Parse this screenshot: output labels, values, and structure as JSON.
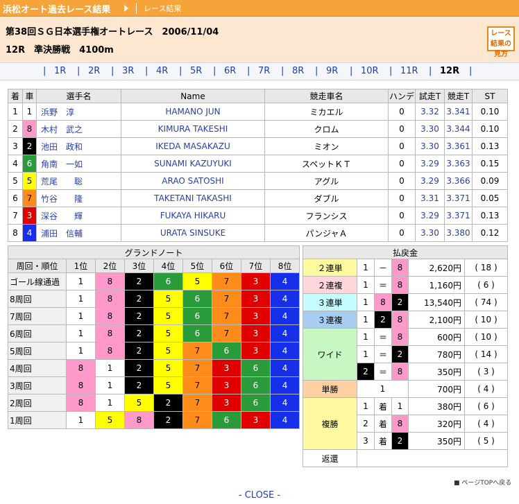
{
  "header": {
    "site_title": "浜松オート過去レース結果",
    "crumb": "レース結果"
  },
  "race": {
    "line1": "第38回ＳＧ日本選手権オートレース　2006/11/04",
    "line2": "12R　準決勝戦　4100m",
    "howto": "レース結果の見方"
  },
  "nav": {
    "tabs": [
      "1R",
      "2R",
      "3R",
      "4R",
      "5R",
      "6R",
      "7R",
      "8R",
      "9R",
      "10R",
      "11R",
      "12R"
    ],
    "current": "12R"
  },
  "results": {
    "headers": [
      "着",
      "車",
      "選手名",
      "Name",
      "競走車名",
      "ハンデ",
      "試走T",
      "競走T",
      "ST"
    ],
    "rows": [
      {
        "pos": "1",
        "car": "1",
        "name": "浜野　淳",
        "romaji": "HAMANO JUN",
        "bike": "ミカエル",
        "handicap": "0",
        "trial": "3.32",
        "race": "3.341",
        "st": "0.10"
      },
      {
        "pos": "2",
        "car": "8",
        "name": "木村　武之",
        "romaji": "KIMURA TAKESHI",
        "bike": "クロム",
        "handicap": "0",
        "trial": "3.30",
        "race": "3.344",
        "st": "0.10"
      },
      {
        "pos": "3",
        "car": "2",
        "name": "池田　政和",
        "romaji": "IKEDA MASAKAZU",
        "bike": "ミオン",
        "handicap": "0",
        "trial": "3.30",
        "race": "3.361",
        "st": "0.13"
      },
      {
        "pos": "4",
        "car": "6",
        "name": "角南　一如",
        "romaji": "SUNAMI KAZUYUKI",
        "bike": "スペットＫＴ",
        "handicap": "0",
        "trial": "3.29",
        "race": "3.363",
        "st": "0.15"
      },
      {
        "pos": "5",
        "car": "5",
        "name": "荒尾　　聡",
        "romaji": "ARAO SATOSHI",
        "bike": "アグル",
        "handicap": "0",
        "trial": "3.29",
        "race": "3.366",
        "st": "0.09"
      },
      {
        "pos": "6",
        "car": "7",
        "name": "竹谷　　隆",
        "romaji": "TAKETANI TAKASHI",
        "bike": "ダブル",
        "handicap": "0",
        "trial": "3.31",
        "race": "3.371",
        "st": "0.05"
      },
      {
        "pos": "7",
        "car": "3",
        "name": "深谷　　輝",
        "romaji": "FUKAYA HIKARU",
        "bike": "フランシス",
        "handicap": "0",
        "trial": "3.29",
        "race": "3.371",
        "st": "0.13"
      },
      {
        "pos": "8",
        "car": "4",
        "name": "浦田　信輔",
        "romaji": "URATA SINSUKE",
        "bike": "パンジャＡ",
        "handicap": "0",
        "trial": "3.30",
        "race": "3.380",
        "st": "0.12"
      }
    ]
  },
  "grand": {
    "title": "グランドノート",
    "headers": [
      "周回・順位",
      "1位",
      "2位",
      "3位",
      "4位",
      "5位",
      "6位",
      "7位",
      "8位"
    ],
    "rows": [
      {
        "lap": "ゴール線通過",
        "cars": [
          "1",
          "8",
          "2",
          "6",
          "5",
          "7",
          "3",
          "4"
        ]
      },
      {
        "lap": "8周回",
        "cars": [
          "1",
          "8",
          "2",
          "5",
          "6",
          "7",
          "3",
          "4"
        ]
      },
      {
        "lap": "7周回",
        "cars": [
          "1",
          "8",
          "2",
          "5",
          "6",
          "7",
          "3",
          "4"
        ]
      },
      {
        "lap": "6周回",
        "cars": [
          "1",
          "8",
          "2",
          "5",
          "6",
          "7",
          "3",
          "4"
        ]
      },
      {
        "lap": "5周回",
        "cars": [
          "1",
          "8",
          "2",
          "5",
          "7",
          "6",
          "3",
          "4"
        ]
      },
      {
        "lap": "4周回",
        "cars": [
          "8",
          "1",
          "2",
          "5",
          "7",
          "3",
          "6",
          "4"
        ]
      },
      {
        "lap": "3周回",
        "cars": [
          "8",
          "1",
          "2",
          "5",
          "7",
          "3",
          "6",
          "4"
        ]
      },
      {
        "lap": "2周回",
        "cars": [
          "8",
          "1",
          "5",
          "2",
          "7",
          "3",
          "6",
          "4"
        ]
      },
      {
        "lap": "1周回",
        "cars": [
          "1",
          "5",
          "8",
          "2",
          "7",
          "6",
          "3",
          "4"
        ]
      }
    ]
  },
  "payout": {
    "title": "払戻金",
    "exacta": {
      "label": "２連単",
      "a": "1",
      "op": "－",
      "b": "8",
      "amount": "2,620円",
      "pop": "( 18 )"
    },
    "quinella": {
      "label": "２連複",
      "a": "1",
      "op": "＝",
      "b": "8",
      "amount": "1,160円",
      "pop": "( 6 )"
    },
    "trifecta": {
      "label": "３連単",
      "a": "1",
      "b": "8",
      "c": "2",
      "amount": "13,540円",
      "pop": "( 74 )"
    },
    "trio": {
      "label": "３連複",
      "a": "1",
      "b": "2",
      "c": "8",
      "amount": "2,100円",
      "pop": "( 10 )"
    },
    "wide": {
      "label": "ワイド",
      "rows": [
        {
          "a": "1",
          "op": "＝",
          "b": "8",
          "amount": "600円",
          "pop": "( 10 )"
        },
        {
          "a": "1",
          "op": "＝",
          "b": "2",
          "amount": "780円",
          "pop": "( 14 )"
        },
        {
          "a": "2",
          "op": "＝",
          "b": "8",
          "amount": "350円",
          "pop": "( 3 )"
        }
      ]
    },
    "win": {
      "label": "単勝",
      "a": "1",
      "amount": "700円",
      "pop": "( 4 )"
    },
    "place": {
      "label": "複勝",
      "mid": "着",
      "rows": [
        {
          "rank": "1",
          "car": "1",
          "amount": "380円",
          "pop": "( 6 )"
        },
        {
          "rank": "2",
          "car": "8",
          "amount": "320円",
          "pop": "( 4 )"
        },
        {
          "rank": "3",
          "car": "2",
          "amount": "350円",
          "pop": "( 5 )"
        }
      ]
    },
    "refund": {
      "label": "返還"
    }
  },
  "footer": {
    "pagetop": "ページTOPへ戻る",
    "close": "- CLOSE -"
  },
  "colors": {
    "car1": "#ffffff",
    "car2": "#000000",
    "car3": "#e00000",
    "car4": "#1530e8",
    "car5": "#ffff00",
    "car6": "#2a9b3a",
    "car7": "#ff8c1a",
    "car8": "#ff99cc"
  }
}
